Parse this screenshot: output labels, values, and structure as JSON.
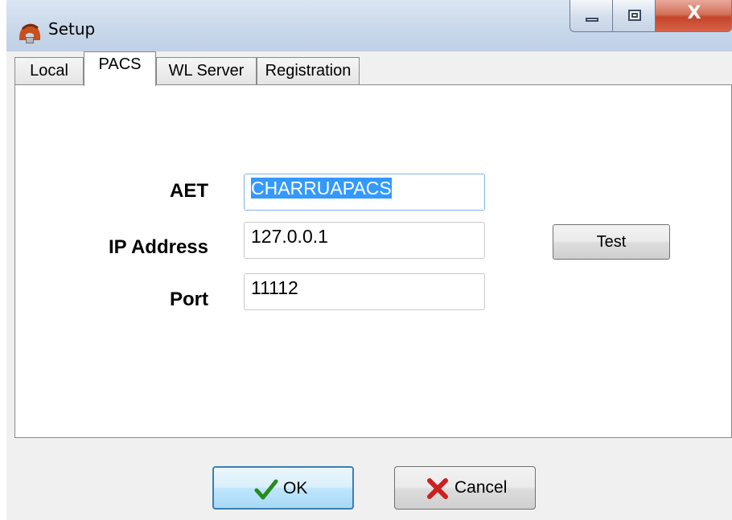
{
  "window": {
    "title": "Setup",
    "icon": "app-helmet-icon",
    "controls": {
      "minimize": "minimize-icon",
      "maximize": "maximize-icon",
      "close": "X"
    }
  },
  "tabs": [
    {
      "label": "Local",
      "active": false
    },
    {
      "label": "PACS",
      "active": true
    },
    {
      "label": "WL Server",
      "active": false
    },
    {
      "label": "Registration",
      "active": false
    }
  ],
  "form": {
    "aet": {
      "label": "AET",
      "value": "CHARRUAPACS",
      "selected": true
    },
    "ip": {
      "label": "IP Address",
      "value": "127.0.0.1"
    },
    "port": {
      "label": "Port",
      "value": "11112"
    },
    "test_label": "Test"
  },
  "buttons": {
    "ok": {
      "label": "OK",
      "icon": "check-icon"
    },
    "cancel": {
      "label": "Cancel",
      "icon": "x-icon"
    }
  },
  "colors": {
    "selection": "#3399ff",
    "ok_check": "#2a8a1e",
    "cancel_x": "#cc1f1f",
    "close_button": "#c4452a"
  }
}
